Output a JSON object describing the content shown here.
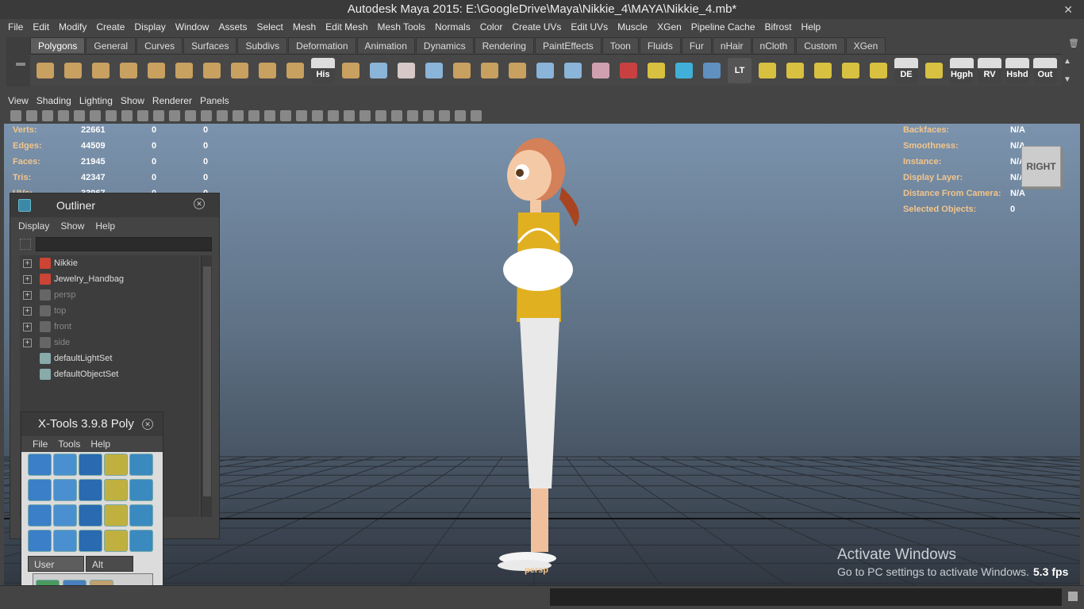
{
  "window": {
    "title": "Autodesk Maya 2015: E:\\GoogleDrive\\Maya\\Nikkie_4\\MAYA\\Nikkie_4.mb*",
    "close_icon": "close-icon"
  },
  "menubar": [
    "File",
    "Edit",
    "Modify",
    "Create",
    "Display",
    "Window",
    "Assets",
    "Select",
    "Mesh",
    "Edit Mesh",
    "Mesh Tools",
    "Normals",
    "Color",
    "Create UVs",
    "Edit UVs",
    "Muscle",
    "XGen",
    "Pipeline Cache",
    "Bifrost",
    "Help"
  ],
  "shelf_tabs": [
    "Polygons",
    "General",
    "Curves",
    "Surfaces",
    "Subdivs",
    "Deformation",
    "Animation",
    "Dynamics",
    "Rendering",
    "PaintEffects",
    "Toon",
    "Fluids",
    "Fur",
    "nHair",
    "nCloth",
    "Custom",
    "XGen"
  ],
  "shelf_active": "Polygons",
  "shelf_icons": [
    {
      "name": "poly-sphere-icon",
      "label": "",
      "color": "#c8a060"
    },
    {
      "name": "poly-cube-icon",
      "label": "",
      "color": "#c8a060"
    },
    {
      "name": "poly-cylinder-icon",
      "label": "",
      "color": "#c8a060"
    },
    {
      "name": "poly-cone-icon",
      "label": "",
      "color": "#c8a060"
    },
    {
      "name": "poly-plane-icon",
      "label": "",
      "color": "#c8a060"
    },
    {
      "name": "poly-torus-icon",
      "label": "",
      "color": "#c8a060"
    },
    {
      "name": "poly-pyramid-icon",
      "label": "",
      "color": "#c8a060"
    },
    {
      "name": "poly-pipe-icon",
      "label": "",
      "color": "#c8a060"
    },
    {
      "name": "poly-helix-icon",
      "label": "",
      "color": "#c8a060"
    },
    {
      "name": "poly-soccer-ball-icon",
      "label": "",
      "color": "#c8a060"
    },
    {
      "name": "history-icon",
      "label": "His",
      "color": "#dddddd"
    },
    {
      "name": "combine-icon",
      "label": "",
      "color": "#c8a060"
    },
    {
      "name": "separate-icon",
      "label": "",
      "color": "#8ab4d8"
    },
    {
      "name": "extract-icon",
      "label": "",
      "color": "#d8c8c8"
    },
    {
      "name": "smooth-icon",
      "label": "",
      "color": "#8ab4d8"
    },
    {
      "name": "extrude-icon",
      "label": "",
      "color": "#c8a060"
    },
    {
      "name": "bridge-icon",
      "label": "",
      "color": "#c8a060"
    },
    {
      "name": "append-polygon-icon",
      "label": "",
      "color": "#c8a060"
    },
    {
      "name": "split-polygon-icon",
      "label": "",
      "color": "#8ab4d8"
    },
    {
      "name": "insert-edge-loop-icon",
      "label": "",
      "color": "#8ab4d8"
    },
    {
      "name": "offset-edge-loop-icon",
      "label": "",
      "color": "#d0a0b0"
    },
    {
      "name": "sculpt-geometry-icon",
      "label": "",
      "color": "#c84040"
    },
    {
      "name": "target-weld-icon",
      "label": "",
      "color": "#d8c040"
    },
    {
      "name": "soft-select-icon",
      "label": "",
      "color": "#40b0d8"
    },
    {
      "name": "uv-editor-icon",
      "label": "",
      "color": "#6090c0"
    },
    {
      "name": "lt-icon",
      "label": "LT",
      "color": "#555555"
    },
    {
      "name": "uv-planar-icon",
      "label": "",
      "color": "#d8c040"
    },
    {
      "name": "uv-cylindrical-icon",
      "label": "",
      "color": "#d8c040"
    },
    {
      "name": "uv-spherical-icon",
      "label": "",
      "color": "#d8c040"
    },
    {
      "name": "uv-automatic-icon",
      "label": "",
      "color": "#d8c040"
    },
    {
      "name": "uv-camera-icon",
      "label": "",
      "color": "#d8c040"
    },
    {
      "name": "display-edges-icon",
      "label": "DE",
      "color": "#d8c040"
    },
    {
      "name": "uv-layout-icon",
      "label": "",
      "color": "#d8c040"
    },
    {
      "name": "hypergraph-icon",
      "label": "Hgph",
      "color": "#dddddd"
    },
    {
      "name": "render-view-icon",
      "label": "RV",
      "color": "#dddddd"
    },
    {
      "name": "hypershade-icon",
      "label": "Hshd",
      "color": "#dddddd"
    },
    {
      "name": "outliner-icon",
      "label": "Out",
      "color": "#dddddd"
    }
  ],
  "panel_menu": [
    "View",
    "Shading",
    "Lighting",
    "Show",
    "Renderer",
    "Panels"
  ],
  "hud_left": [
    {
      "label": "Verts:",
      "v1": "22661",
      "v2": "0",
      "v3": "0"
    },
    {
      "label": "Edges:",
      "v1": "44509",
      "v2": "0",
      "v3": "0"
    },
    {
      "label": "Faces:",
      "v1": "21945",
      "v2": "0",
      "v3": "0"
    },
    {
      "label": "Tris:",
      "v1": "42347",
      "v2": "0",
      "v3": "0"
    },
    {
      "label": "UVs:",
      "v1": "33967",
      "v2": "0",
      "v3": "0"
    }
  ],
  "hud_right": [
    {
      "label": "Backfaces:",
      "value": "N/A"
    },
    {
      "label": "Smoothness:",
      "value": "N/A"
    },
    {
      "label": "Instance:",
      "value": "N/A"
    },
    {
      "label": "Display Layer:",
      "value": "N/A"
    },
    {
      "label": "Distance From Camera:",
      "value": "N/A"
    },
    {
      "label": "Selected Objects:",
      "value": "0"
    }
  ],
  "viewcube": "RIGHT",
  "camera": "persp",
  "fps": "5.3 fps",
  "activate": {
    "line1": "Activate Windows",
    "line2": "Go to PC settings to activate Windows."
  },
  "outliner": {
    "title": "Outliner",
    "menu": [
      "Display",
      "Show",
      "Help"
    ],
    "items": [
      {
        "label": "Nikkie",
        "icon": "mesh-transform-icon",
        "expand": true,
        "dim": false
      },
      {
        "label": "Jewelry_Handbag",
        "icon": "mesh-transform-icon",
        "expand": true,
        "dim": false
      },
      {
        "label": "persp",
        "icon": "camera-icon",
        "expand": true,
        "dim": true
      },
      {
        "label": "top",
        "icon": "camera-icon",
        "expand": true,
        "dim": true
      },
      {
        "label": "front",
        "icon": "camera-icon",
        "expand": true,
        "dim": true
      },
      {
        "label": "side",
        "icon": "camera-icon",
        "expand": true,
        "dim": true
      },
      {
        "label": "defaultLightSet",
        "icon": "set-icon",
        "expand": false,
        "dim": false
      },
      {
        "label": "defaultObjectSet",
        "icon": "set-icon",
        "expand": false,
        "dim": false
      }
    ]
  },
  "xtools": {
    "title": "X-Tools 3.9.8 Poly",
    "menu": [
      "File",
      "Tools",
      "Help"
    ],
    "shelf_tabs": [
      "User Shelf",
      "Alt Shelf"
    ],
    "tool_icons": [
      "x-tool-1-icon",
      "x-tool-2-icon",
      "x-tool-3-icon",
      "x-tool-4-icon",
      "x-tool-5-icon",
      "x-tool-6-icon",
      "x-tool-7-icon",
      "x-tool-8-icon",
      "x-tool-9-icon",
      "x-tool-10-icon",
      "x-tool-11-icon",
      "x-tool-12-icon",
      "x-tool-13-icon",
      "x-tool-14-icon",
      "x-tool-15-icon",
      "x-tool-16-icon",
      "x-tool-17-icon",
      "x-tool-18-icon",
      "x-tool-19-icon",
      "x-tool-20-icon"
    ],
    "user_icons": [
      "transfer-icon",
      "cone-icon",
      "texture-plane-icon"
    ]
  }
}
